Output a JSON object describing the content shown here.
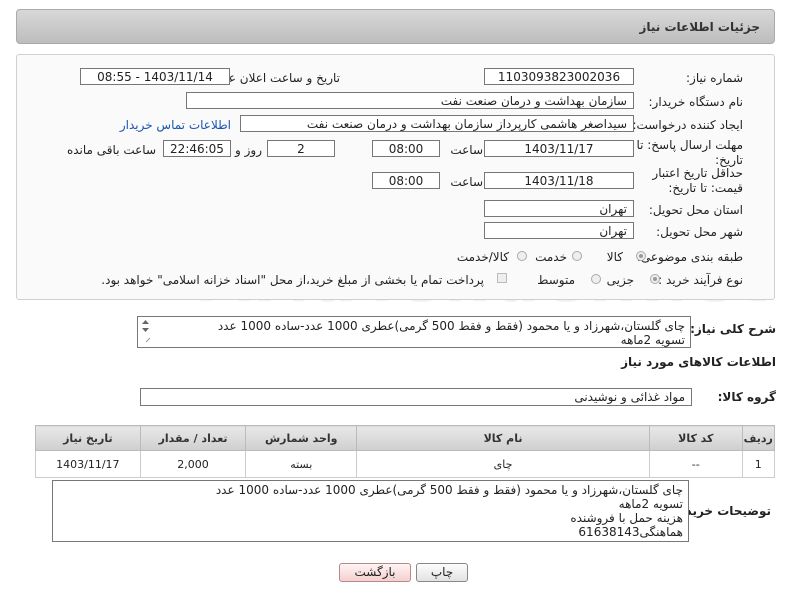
{
  "header": {
    "title": "جزئیات اطلاعات نیاز"
  },
  "form": {
    "need_number_label": "شماره نیاز:",
    "need_number": "1103093823002036",
    "announce_label": "تاریخ و ساعت اعلان عمومی:",
    "announce_value": "1403/11/14 - 08:55",
    "buyer_org_label": "نام دستگاه خریدار:",
    "buyer_org": "سازمان بهداشت و درمان صنعت نفت",
    "creator_label": "ایجاد کننده درخواست:",
    "creator": "سیداصغر هاشمی کارپرداز سازمان بهداشت و درمان صنعت نفت",
    "contact_link": "اطلاعات تماس خریدار",
    "deadline_label": "مهلت ارسال پاسخ: تا تاریخ:",
    "deadline_date": "1403/11/17",
    "time_label": "ساعت",
    "deadline_time": "08:00",
    "days_value": "2",
    "days_label": "روز و",
    "remaining_time": "22:46:05",
    "remaining_label": "ساعت باقی مانده",
    "validity_label": "حداقل تاریخ اعتبار قیمت: تا تاریخ:",
    "validity_date": "1403/11/18",
    "validity_time": "08:00",
    "province_label": "استان محل تحویل:",
    "province": "تهران",
    "city_label": "شهر محل تحویل:",
    "city": "تهران",
    "category_label": "طبقه بندی موضوعی:",
    "category_options": [
      "کالا",
      "خدمت",
      "کالا/خدمت"
    ],
    "process_label": "نوع فرآیند خرید :",
    "process_options": [
      "جزیی",
      "متوسط"
    ],
    "payment_note": "پرداخت تمام یا بخشی از مبلغ خرید،از محل \"اسناد خزانه اسلامی\" خواهد بود."
  },
  "description": {
    "label": "شرح کلی نیاز:",
    "text": "چای گلستان،شهرزاد و یا محمود (فقط و فقط 500 گرمی)عطری 1000 عدد-ساده 1000 عدد\nتسویه 2ماهه"
  },
  "goods_section": {
    "title": "اطلاعات کالاهای مورد نیاز",
    "group_label": "گروه کالا:",
    "group_value": "مواد غذائی و نوشیدنی",
    "columns": [
      "ردیف",
      "کد کالا",
      "نام کالا",
      "واحد شمارش",
      "تعداد / مقدار",
      "تاریخ نیاز"
    ],
    "rows": [
      [
        "1",
        "--",
        "چای",
        "بسته",
        "2,000",
        "1403/11/17"
      ]
    ]
  },
  "buyer_notes": {
    "label": "توضیحات خریدار:",
    "text": "چای گلستان،شهرزاد و یا محمود (فقط و فقط 500 گرمی)عطری 1000 عدد-ساده 1000 عدد\nتسویه 2ماهه\nهزینه حمل با فروشنده\nهماهنگی61638143"
  },
  "buttons": {
    "print": "چاپ",
    "back": "بازگشت"
  },
  "watermark": "AriaTender.net"
}
